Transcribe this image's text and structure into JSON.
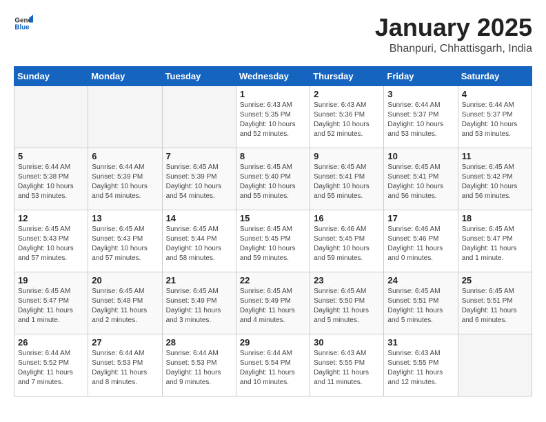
{
  "header": {
    "logo_general": "General",
    "logo_blue": "Blue",
    "title": "January 2025",
    "subtitle": "Bhanpuri, Chhattisgarh, India"
  },
  "days_of_week": [
    "Sunday",
    "Monday",
    "Tuesday",
    "Wednesday",
    "Thursday",
    "Friday",
    "Saturday"
  ],
  "weeks": [
    [
      {
        "day": "",
        "info": ""
      },
      {
        "day": "",
        "info": ""
      },
      {
        "day": "",
        "info": ""
      },
      {
        "day": "1",
        "info": "Sunrise: 6:43 AM\nSunset: 5:35 PM\nDaylight: 10 hours\nand 52 minutes."
      },
      {
        "day": "2",
        "info": "Sunrise: 6:43 AM\nSunset: 5:36 PM\nDaylight: 10 hours\nand 52 minutes."
      },
      {
        "day": "3",
        "info": "Sunrise: 6:44 AM\nSunset: 5:37 PM\nDaylight: 10 hours\nand 53 minutes."
      },
      {
        "day": "4",
        "info": "Sunrise: 6:44 AM\nSunset: 5:37 PM\nDaylight: 10 hours\nand 53 minutes."
      }
    ],
    [
      {
        "day": "5",
        "info": "Sunrise: 6:44 AM\nSunset: 5:38 PM\nDaylight: 10 hours\nand 53 minutes."
      },
      {
        "day": "6",
        "info": "Sunrise: 6:44 AM\nSunset: 5:39 PM\nDaylight: 10 hours\nand 54 minutes."
      },
      {
        "day": "7",
        "info": "Sunrise: 6:45 AM\nSunset: 5:39 PM\nDaylight: 10 hours\nand 54 minutes."
      },
      {
        "day": "8",
        "info": "Sunrise: 6:45 AM\nSunset: 5:40 PM\nDaylight: 10 hours\nand 55 minutes."
      },
      {
        "day": "9",
        "info": "Sunrise: 6:45 AM\nSunset: 5:41 PM\nDaylight: 10 hours\nand 55 minutes."
      },
      {
        "day": "10",
        "info": "Sunrise: 6:45 AM\nSunset: 5:41 PM\nDaylight: 10 hours\nand 56 minutes."
      },
      {
        "day": "11",
        "info": "Sunrise: 6:45 AM\nSunset: 5:42 PM\nDaylight: 10 hours\nand 56 minutes."
      }
    ],
    [
      {
        "day": "12",
        "info": "Sunrise: 6:45 AM\nSunset: 5:43 PM\nDaylight: 10 hours\nand 57 minutes."
      },
      {
        "day": "13",
        "info": "Sunrise: 6:45 AM\nSunset: 5:43 PM\nDaylight: 10 hours\nand 57 minutes."
      },
      {
        "day": "14",
        "info": "Sunrise: 6:45 AM\nSunset: 5:44 PM\nDaylight: 10 hours\nand 58 minutes."
      },
      {
        "day": "15",
        "info": "Sunrise: 6:45 AM\nSunset: 5:45 PM\nDaylight: 10 hours\nand 59 minutes."
      },
      {
        "day": "16",
        "info": "Sunrise: 6:46 AM\nSunset: 5:45 PM\nDaylight: 10 hours\nand 59 minutes."
      },
      {
        "day": "17",
        "info": "Sunrise: 6:46 AM\nSunset: 5:46 PM\nDaylight: 11 hours\nand 0 minutes."
      },
      {
        "day": "18",
        "info": "Sunrise: 6:45 AM\nSunset: 5:47 PM\nDaylight: 11 hours\nand 1 minute."
      }
    ],
    [
      {
        "day": "19",
        "info": "Sunrise: 6:45 AM\nSunset: 5:47 PM\nDaylight: 11 hours\nand 1 minute."
      },
      {
        "day": "20",
        "info": "Sunrise: 6:45 AM\nSunset: 5:48 PM\nDaylight: 11 hours\nand 2 minutes."
      },
      {
        "day": "21",
        "info": "Sunrise: 6:45 AM\nSunset: 5:49 PM\nDaylight: 11 hours\nand 3 minutes."
      },
      {
        "day": "22",
        "info": "Sunrise: 6:45 AM\nSunset: 5:49 PM\nDaylight: 11 hours\nand 4 minutes."
      },
      {
        "day": "23",
        "info": "Sunrise: 6:45 AM\nSunset: 5:50 PM\nDaylight: 11 hours\nand 5 minutes."
      },
      {
        "day": "24",
        "info": "Sunrise: 6:45 AM\nSunset: 5:51 PM\nDaylight: 11 hours\nand 5 minutes."
      },
      {
        "day": "25",
        "info": "Sunrise: 6:45 AM\nSunset: 5:51 PM\nDaylight: 11 hours\nand 6 minutes."
      }
    ],
    [
      {
        "day": "26",
        "info": "Sunrise: 6:44 AM\nSunset: 5:52 PM\nDaylight: 11 hours\nand 7 minutes."
      },
      {
        "day": "27",
        "info": "Sunrise: 6:44 AM\nSunset: 5:53 PM\nDaylight: 11 hours\nand 8 minutes."
      },
      {
        "day": "28",
        "info": "Sunrise: 6:44 AM\nSunset: 5:53 PM\nDaylight: 11 hours\nand 9 minutes."
      },
      {
        "day": "29",
        "info": "Sunrise: 6:44 AM\nSunset: 5:54 PM\nDaylight: 11 hours\nand 10 minutes."
      },
      {
        "day": "30",
        "info": "Sunrise: 6:43 AM\nSunset: 5:55 PM\nDaylight: 11 hours\nand 11 minutes."
      },
      {
        "day": "31",
        "info": "Sunrise: 6:43 AM\nSunset: 5:55 PM\nDaylight: 11 hours\nand 12 minutes."
      },
      {
        "day": "",
        "info": ""
      }
    ]
  ]
}
